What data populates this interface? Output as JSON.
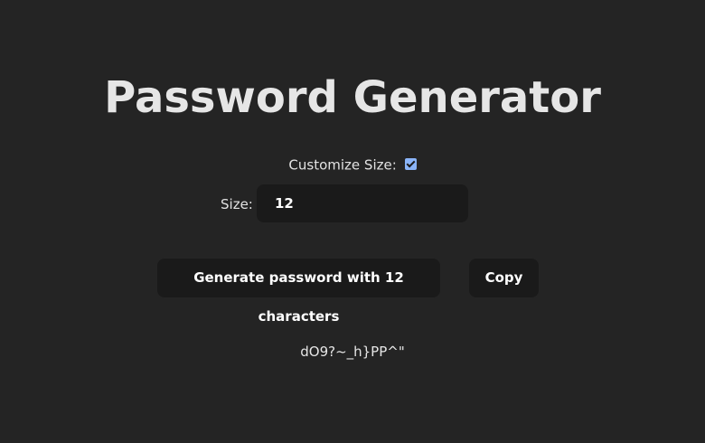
{
  "header": {
    "title": "Password Generator"
  },
  "options": {
    "customize_label": "Customize Size:",
    "customize_checked": true,
    "size_label": "Size:",
    "size_value": "12"
  },
  "actions": {
    "generate_label": "Generate password with 12 characters",
    "copy_label": "Copy"
  },
  "output": {
    "password": "dO9?~_h}PP^\""
  },
  "colors": {
    "background": "#242424",
    "surface": "#1a1a1a",
    "checkbox_accent": "#8ab4f8",
    "text": "#e6e6e6"
  }
}
